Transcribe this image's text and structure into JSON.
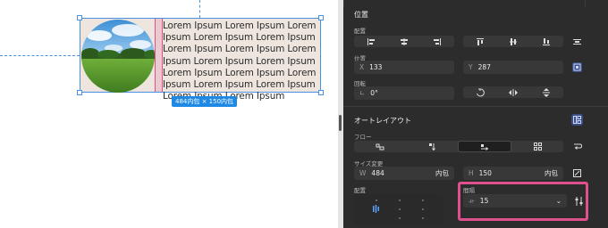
{
  "canvas": {
    "lorem_text": "Lorem Ipsum Lorem Ipsum Lorem Ipsum Lorem Ipsum Lorem Ipsum Lorem Ipsum Lorem Ipsum Lorem Ipsum Lorem Ipsum Lorem Ipsum Lorem Ipsum Lorem Ipsum Lorem Ipsum Lorem Ipsum Lorem Ipsum Lorem Ipsum Lorem Ipsum",
    "size_badge": "484内包 × 150内包",
    "selection_color": "#4a90e2",
    "gap_marker_color": "#e0508c"
  },
  "panel": {
    "position_section": {
      "title": "位置",
      "alignment_label": "配置",
      "position_label": "位置",
      "x_key": "X",
      "x_value": "133",
      "y_key": "Y",
      "y_value": "287",
      "rotation_label": "回転",
      "rotation_value": "0°"
    },
    "autolayout_section": {
      "title": "オートレイアウト",
      "flow_label": "フロー",
      "resize_label": "サイズ変更",
      "w_key": "W",
      "w_value": "484",
      "w_suffix": "内包",
      "h_key": "H",
      "h_value": "150",
      "h_suffix": "内包",
      "alignment_label": "配置",
      "gap_label": "間隔",
      "gap_value": "15"
    },
    "highlight_color": "#e0508c",
    "accent_color": "#3a4f85"
  }
}
